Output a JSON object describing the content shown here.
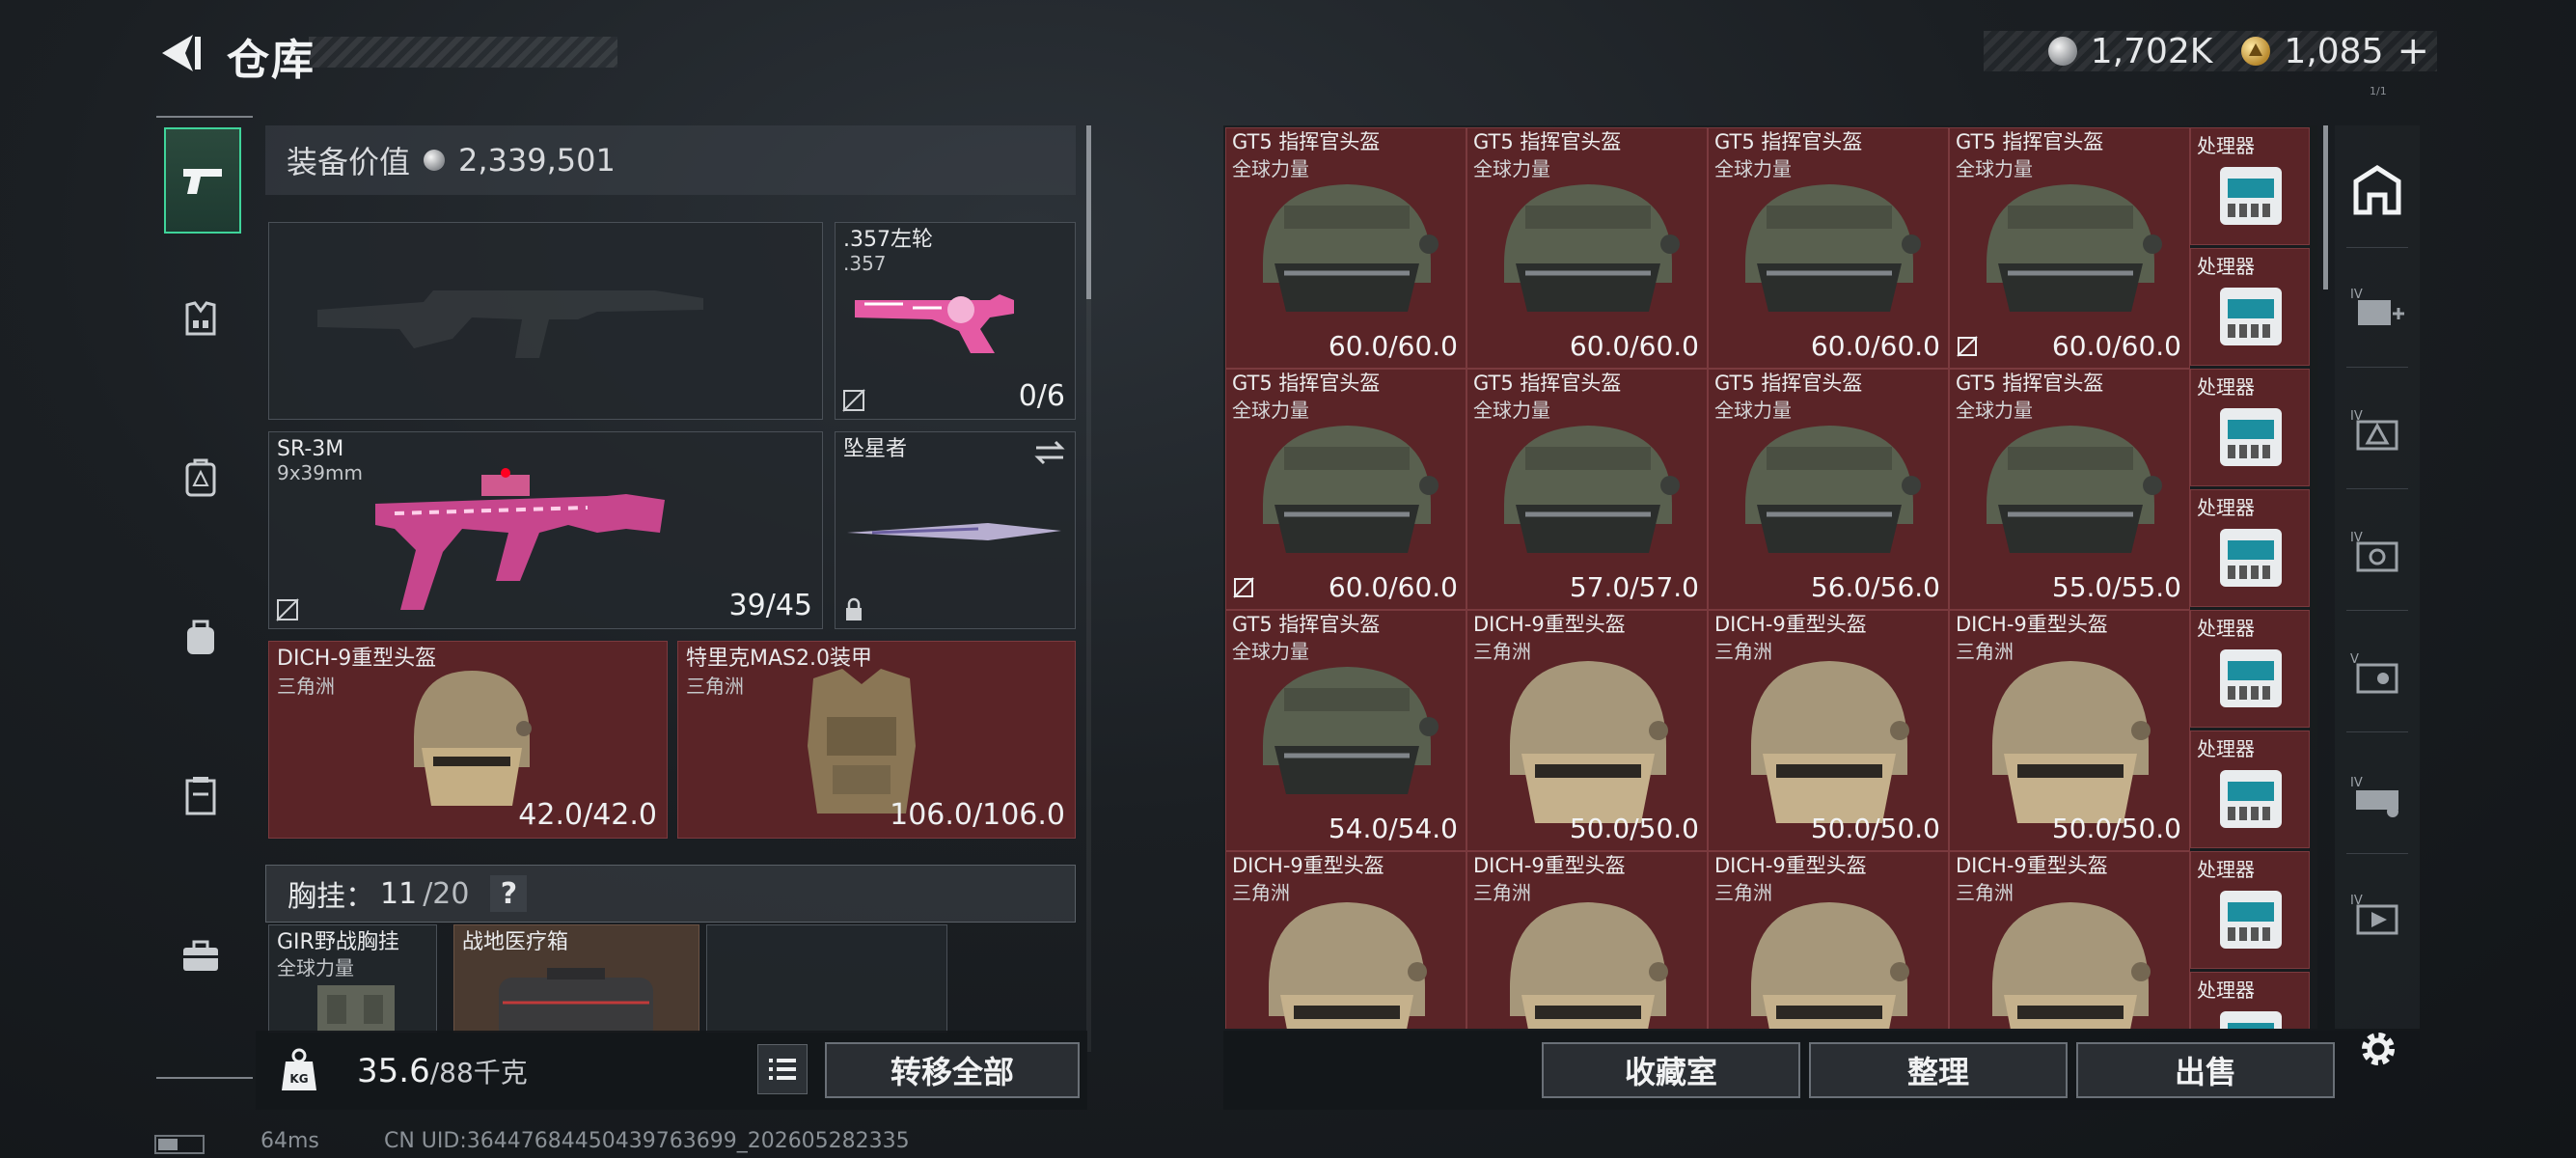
{
  "header": {
    "title": "仓库",
    "currency_silver": "1,702K",
    "currency_gold": "1,085",
    "add_symbol": "+",
    "tiny_label": "1/1"
  },
  "equipment": {
    "value_label": "装备价值",
    "value_amount": "2,339,501",
    "revolver": {
      "name": ".357左轮",
      "ammo": ".357",
      "count": "0/6"
    },
    "smg": {
      "name": "SR-3M",
      "ammo": "9x39mm",
      "count": "39/45"
    },
    "melee": {
      "name": "坠星者"
    },
    "helmet": {
      "name": "DICH-9重型头盔",
      "origin": "三角洲",
      "durability": "42.0/42.0"
    },
    "armor": {
      "name": "特里克MAS2.0装甲",
      "origin": "三角洲",
      "durability": "106.0/106.0"
    },
    "chest": {
      "label": "胸挂：",
      "count": "11",
      "capacity": "/20",
      "help": "?"
    },
    "chest_items": [
      {
        "name": "GIR野战胸挂",
        "sub": "全球力量"
      },
      {
        "name": "战地医疗箱"
      }
    ]
  },
  "weight": {
    "current": "35.6",
    "capacity": "/88千克"
  },
  "buttons": {
    "transfer_all": "转移全部",
    "collection": "收藏室",
    "organize": "整理",
    "sell": "出售"
  },
  "grid": {
    "rows": [
      [
        {
          "name": "GT5 指挥官头盔",
          "sub": "全球力量",
          "dur": "60.0/60.0",
          "kind": "gt5"
        },
        {
          "name": "GT5 指挥官头盔",
          "sub": "全球力量",
          "dur": "60.0/60.0",
          "kind": "gt5"
        },
        {
          "name": "GT5 指挥官头盔",
          "sub": "全球力量",
          "dur": "60.0/60.0",
          "kind": "gt5"
        },
        {
          "name": "GT5 指挥官头盔",
          "sub": "全球力量",
          "dur": "60.0/60.0",
          "kind": "gt5",
          "marked": true
        }
      ],
      [
        {
          "name": "GT5 指挥官头盔",
          "sub": "全球力量",
          "dur": "60.0/60.0",
          "kind": "gt5",
          "marked": true
        },
        {
          "name": "GT5 指挥官头盔",
          "sub": "全球力量",
          "dur": "57.0/57.0",
          "kind": "gt5"
        },
        {
          "name": "GT5 指挥官头盔",
          "sub": "全球力量",
          "dur": "56.0/56.0",
          "kind": "gt5"
        },
        {
          "name": "GT5 指挥官头盔",
          "sub": "全球力量",
          "dur": "55.0/55.0",
          "kind": "gt5"
        }
      ],
      [
        {
          "name": "GT5 指挥官头盔",
          "sub": "全球力量",
          "dur": "54.0/54.0",
          "kind": "gt5"
        },
        {
          "name": "DICH-9重型头盔",
          "sub": "三角洲",
          "dur": "50.0/50.0",
          "kind": "dich"
        },
        {
          "name": "DICH-9重型头盔",
          "sub": "三角洲",
          "dur": "50.0/50.0",
          "kind": "dich"
        },
        {
          "name": "DICH-9重型头盔",
          "sub": "三角洲",
          "dur": "50.0/50.0",
          "kind": "dich"
        }
      ],
      [
        {
          "name": "DICH-9重型头盔",
          "sub": "三角洲",
          "dur": "",
          "kind": "dich"
        },
        {
          "name": "DICH-9重型头盔",
          "sub": "三角洲",
          "dur": "",
          "kind": "dich"
        },
        {
          "name": "DICH-9重型头盔",
          "sub": "三角洲",
          "dur": "",
          "kind": "dich"
        },
        {
          "name": "DICH-9重型头盔",
          "sub": "三角洲",
          "dur": "",
          "kind": "dich"
        }
      ]
    ],
    "processor_label": "处理器",
    "processor_count": 8
  },
  "footer": {
    "ping": "64ms",
    "uid": "CN UID:3644768445043976369​9_202605282335"
  },
  "colors": {
    "accent": "#3fd49a",
    "cell_red": "#5a2427",
    "panel": "#23282d"
  }
}
